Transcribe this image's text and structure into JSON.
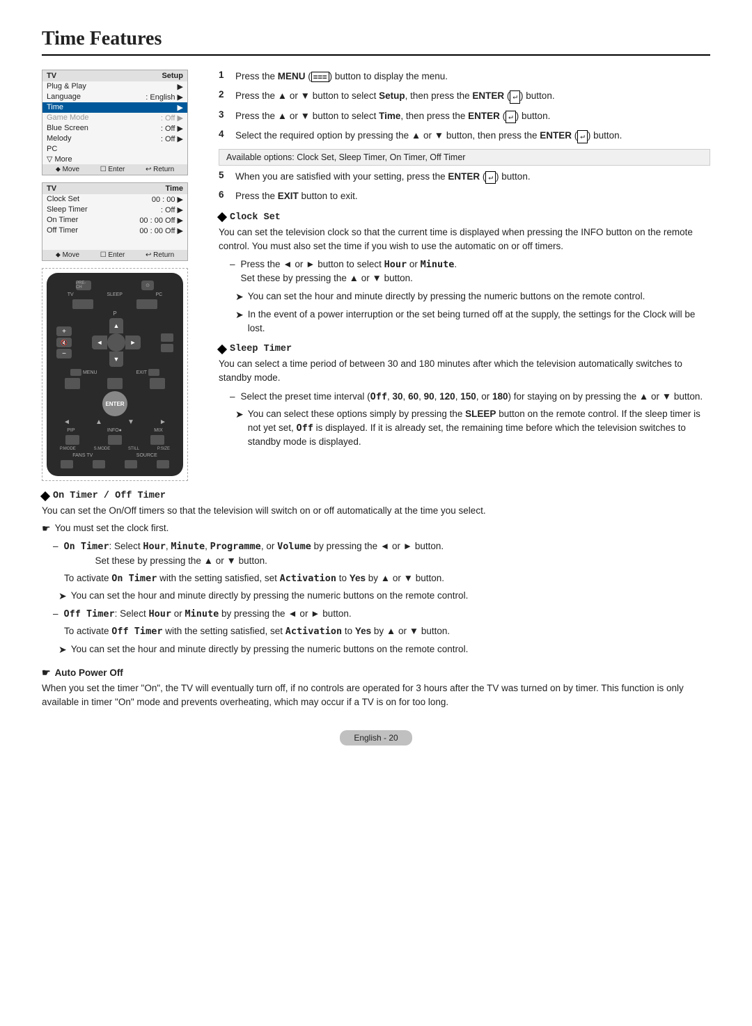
{
  "page": {
    "title": "Time Features",
    "footer": "English - 20"
  },
  "menu1": {
    "title_left": "TV",
    "title_right": "Setup",
    "rows": [
      {
        "label": "Plug & Play",
        "value": "",
        "arrow": true
      },
      {
        "label": "Language",
        "value": ": English",
        "arrow": true
      },
      {
        "label": "Time",
        "value": "",
        "arrow": true,
        "highlight": true
      },
      {
        "label": "Game Mode",
        "value": ": Off",
        "arrow": true,
        "grayed": true
      },
      {
        "label": "Blue Screen",
        "value": ": Off",
        "arrow": true
      },
      {
        "label": "Melody",
        "value": ": Off",
        "arrow": true
      },
      {
        "label": "PC",
        "value": "",
        "arrow": false
      },
      {
        "label": "▽ More",
        "value": "",
        "arrow": false
      }
    ],
    "footer_items": [
      "⬡ Move",
      "☐ Enter",
      "⬡ Return"
    ]
  },
  "menu2": {
    "title_left": "TV",
    "title_right": "Time",
    "rows": [
      {
        "label": "Clock Set",
        "value": "00 : 00",
        "arrow": true
      },
      {
        "label": "Sleep Timer",
        "value": ": Off",
        "arrow": true
      },
      {
        "label": "On Timer",
        "value": "00 : 00  Off",
        "arrow": true
      },
      {
        "label": "Off Timer",
        "value": "00 : 00  Off",
        "arrow": true
      }
    ],
    "footer_items": [
      "⬡ Move",
      "☐ Enter",
      "⬡ Return"
    ]
  },
  "steps": [
    {
      "num": "1",
      "parts": [
        "Press the ",
        "MENU",
        " (",
        "☰☰☰",
        ") button to display the menu."
      ]
    },
    {
      "num": "2",
      "parts": [
        "Press the ▲ or ▼ button to select ",
        "Setup",
        ", then press the ",
        "ENTER",
        " (",
        "↵",
        ") button."
      ]
    },
    {
      "num": "3",
      "parts": [
        "Press the ▲ or ▼ button to select ",
        "Time",
        ", then press the ",
        "ENTER",
        " (",
        "↵",
        ") button."
      ]
    },
    {
      "num": "4",
      "parts": [
        "Select the required option by pressing the ▲ or ▼ button, then press the ",
        "ENTER",
        " (",
        "↵",
        ") button."
      ]
    },
    {
      "num": "5",
      "parts": [
        "When you are satisfied with your setting, press the ",
        "ENTER",
        " (",
        "↵",
        ") button."
      ]
    },
    {
      "num": "6",
      "parts": [
        "Press the ",
        "EXIT",
        " button to exit."
      ]
    }
  ],
  "available_options": "Available options: Clock Set, Sleep Timer, On Timer, Off Timer",
  "sections": {
    "clock_set": {
      "title": "Clock Set",
      "desc": "You can set the television clock so that the current time is displayed when pressing the INFO button on the remote control. You must also set the time if you wish to use the automatic on or off timers.",
      "sub1": {
        "dash": "Press the ◄ or ► button to select Hour or Minute.",
        "dash2": "Set these by pressing the ▲ or ▼ button."
      },
      "arrow1": "You can set the hour and minute directly by pressing the numeric buttons on the remote control.",
      "arrow2": "In the event of a power interruption or the set being turned off at the supply, the settings for the Clock will be lost."
    },
    "sleep_timer": {
      "title": "Sleep Timer",
      "desc": "You can select a time period of between 30 and 180 minutes after which the television automatically switches to standby mode.",
      "dash": "Select the preset time interval (Off, 30, 60, 90, 120, 150, or 180) for staying on by pressing the ▲ or ▼ button.",
      "arrow": "You can select these options simply by pressing the SLEEP button on the remote control. If the sleep timer is not yet set, Off is displayed. If it is already set, the remaining time before which the television switches to standby mode is displayed."
    },
    "on_off_timer": {
      "title": "On Timer / Off Timer",
      "desc": "You can set the On/Off timers so that the television will switch on or off automatically at the time you select.",
      "hand": "You must set the clock first.",
      "on_timer_label": "On Timer:",
      "on_timer_desc": "Select Hour, Minute, Programme, or Volume by pressing the ◄ or ► button.",
      "on_timer_sub": "Set these by pressing the ▲ or ▼ button.",
      "on_timer_activate": "To activate On Timer with the setting satisfied, set Activation to Yes by ▲ or ▼ button.",
      "on_timer_arrow": "You can set the hour and minute directly by pressing the numeric buttons on the remote control.",
      "off_timer_label": "Off Timer:",
      "off_timer_desc": "Select Hour or Minute by pressing the ◄ or ► button.",
      "off_timer_activate": "To activate Off Timer with the setting satisfied, set Activation to Yes by ▲ or ▼ button.",
      "off_timer_arrow": "You can set the hour and minute directly by pressing the numeric buttons on the remote control."
    },
    "auto_power_off": {
      "title": "Auto Power Off",
      "desc": "When you set the timer \"On\", the TV will eventually turn off, if no controls are operated for 3 hours after the TV was turned on by timer. This function is only available in timer \"On\" mode and prevents overheating, which may occur if a TV is on for too long."
    }
  }
}
